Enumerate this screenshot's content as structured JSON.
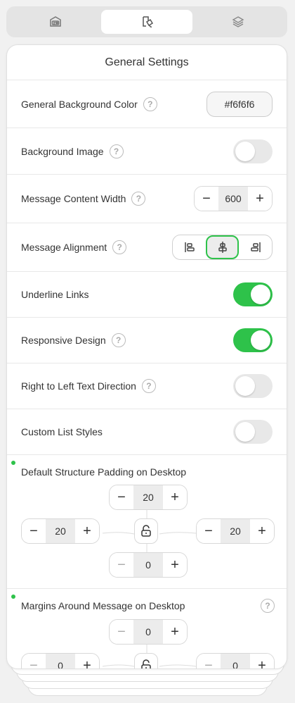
{
  "tabs": [
    {
      "icon": "content-card-icon",
      "active": false
    },
    {
      "icon": "paint-bucket-icon",
      "active": true
    },
    {
      "icon": "layers-icon",
      "active": false
    }
  ],
  "panel": {
    "title": "General Settings",
    "background_color": {
      "label": "General Background Color",
      "value": "#f6f6f6"
    },
    "background_image": {
      "label": "Background Image",
      "on": false
    },
    "content_width": {
      "label": "Message Content Width",
      "value": "600"
    },
    "alignment": {
      "label": "Message Alignment",
      "selected": "center"
    },
    "underline_links": {
      "label": "Underline Links",
      "on": true
    },
    "responsive": {
      "label": "Responsive Design",
      "on": true
    },
    "rtl": {
      "label": "Right to Left Text Direction",
      "on": false
    },
    "custom_list": {
      "label": "Custom List Styles",
      "on": false
    },
    "padding": {
      "title": "Default Structure Padding on Desktop",
      "top": "20",
      "left": "20",
      "right": "20",
      "bottom": "0"
    },
    "margins": {
      "title": "Margins Around Message on Desktop",
      "top": "0",
      "left": "0",
      "right": "0"
    }
  },
  "colors": {
    "accent": "#2ec24a"
  }
}
